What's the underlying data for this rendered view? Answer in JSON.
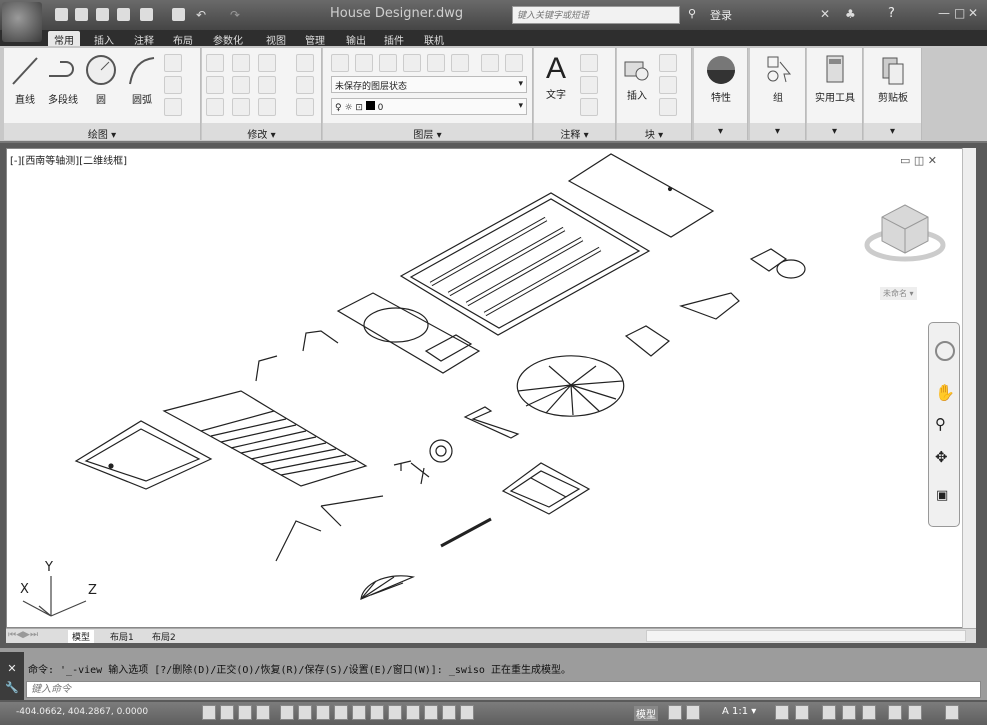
{
  "title": "House Designer.dwg",
  "search": {
    "placeholder": "键入关键字或短语"
  },
  "login": "登录",
  "window_controls": [
    "—",
    "□",
    "✕"
  ],
  "tabs": [
    "常用",
    "插入",
    "注释",
    "布局",
    "参数化",
    "视图",
    "管理",
    "输出",
    "插件",
    "联机"
  ],
  "ribbon": {
    "draw": {
      "label": "绘图 ▾",
      "items": [
        "直线",
        "多段线",
        "圆",
        "圆弧"
      ]
    },
    "modify": {
      "label": "修改 ▾"
    },
    "layers": {
      "label": "图层 ▾",
      "layer_state": "未保存的图层状态",
      "current_layer": "0"
    },
    "annotation": {
      "label": "注释 ▾",
      "text": "文字"
    },
    "block": {
      "label": "块 ▾",
      "insert": "插入"
    },
    "properties": "特性",
    "groups": "组",
    "utilities": "实用工具",
    "clipboard": "剪贴板"
  },
  "viewport": {
    "label": "[-][西南等轴测][二维线框]",
    "viewcube_label": "未命名 ▾",
    "ucs": {
      "x": "X",
      "y": "Y",
      "z": "Z"
    }
  },
  "layout_tabs": [
    "模型",
    "布局1",
    "布局2"
  ],
  "command": {
    "history": "命令: '_-view 输入选项 [?/删除(D)/正交(O)/恢复(R)/保存(S)/设置(E)/窗口(W)]: _swiso 正在重生成模型。",
    "placeholder": "键入命令"
  },
  "status": {
    "coords": "-404.0662, 404.2867, 0.0000",
    "model": "模型",
    "scale": "1:1"
  }
}
